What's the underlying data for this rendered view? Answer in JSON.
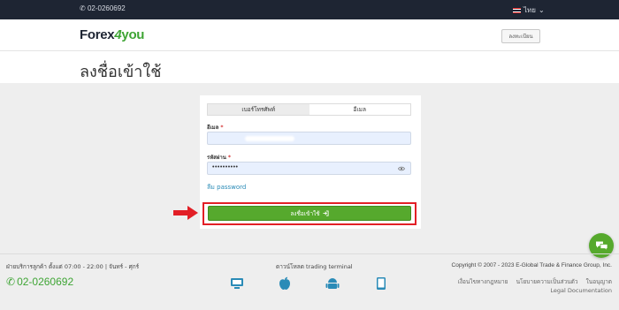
{
  "topbar": {
    "phone": "02-0260692",
    "language": "ไทย"
  },
  "header": {
    "logo_part1": "Forex",
    "logo_part2": "4",
    "logo_part3": "you",
    "register_label": "ลงทะเบียน"
  },
  "page": {
    "title": "ลงชื่อเข้าใช้"
  },
  "login_form": {
    "tabs": [
      {
        "label": "เบอร์โทรศัพท์",
        "active": true
      },
      {
        "label": "อีเมล",
        "active": false
      }
    ],
    "email_label": "อีเมล",
    "password_label": "รหัสผ่าน",
    "required_mark": "*",
    "password_value": "••••••••••",
    "forgot_password": "ลืม password",
    "login_button": "ลงชื่อเข้าใช้"
  },
  "footer": {
    "support_hours": "ฝ่ายบริการลูกค้า ตั้งแต่ 07:00 - 22:00 | จันทร์ - ศุกร์",
    "phone": "02-0260692",
    "download_label": "ดาวน์โหลด trading terminal",
    "platforms": [
      "desktop-icon",
      "apple-icon",
      "android-icon",
      "tablet-icon"
    ],
    "copyright": "Copyright © 2007 - 2023 E-Global Trade & Finance Group, Inc.",
    "links": [
      "เงื่อนไขทางกฎหมาย",
      "นโยบายความเป็นส่วนตัว",
      "ในอนุญาต",
      "Legal Documentation"
    ]
  },
  "colors": {
    "brand_green": "#56a92d",
    "topbar_bg": "#1e2533",
    "highlight_red": "#e21f26",
    "link_blue": "#2a8bb7"
  }
}
